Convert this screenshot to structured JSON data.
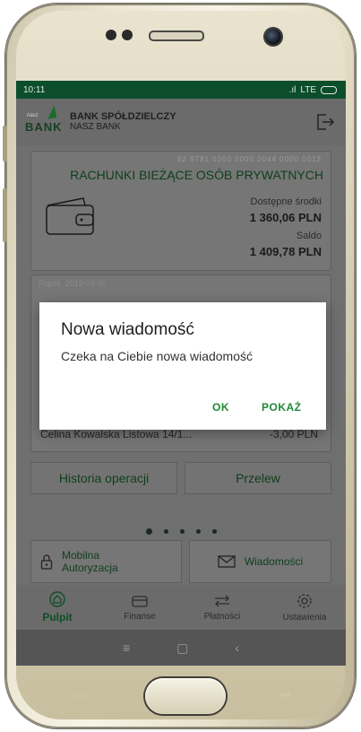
{
  "status": {
    "time": "10:11",
    "network": "LTE"
  },
  "header": {
    "logo_small": "nasz",
    "logo_text": "BANK",
    "bank_name": "BANK SPÓŁDZIELCZY",
    "bank_sub": "NASZ BANK"
  },
  "account": {
    "number": "82 8781 0000 0000 0044 0000 0013",
    "title": "RACHUNKI BIEŻĄCE OSÓB PRYWATNYCH",
    "available_label": "Dostępne środki",
    "available_value": "1 360,06 PLN",
    "balance_label": "Saldo",
    "balance_value": "1 409,78 PLN"
  },
  "operations": {
    "date": "Piątek, 2019-08-30",
    "row_name": "Celina Kowalska Listowa 14/1...",
    "row_amount": "-3,00 PLN"
  },
  "buttons": {
    "history": "Historia operacji",
    "transfer": "Przelew"
  },
  "pager": {
    "count": 5,
    "active": 0
  },
  "tiles": {
    "auth": "Mobilna\nAutoryzacja",
    "messages": "Wiadomości"
  },
  "tabs": [
    {
      "label": "Pulpit",
      "icon": "home-icon"
    },
    {
      "label": "Finanse",
      "icon": "wallet-icon"
    },
    {
      "label": "Płatności",
      "icon": "transfer-icon"
    },
    {
      "label": "Ustawienia",
      "icon": "gear-icon"
    }
  ],
  "dialog": {
    "title": "Nowa wiadomość",
    "message": "Czeka na Ciebie nowa wiadomość",
    "ok": "OK",
    "show": "POKAŻ"
  },
  "colors": {
    "brand_green": "#0c4e2b",
    "accent_green": "#1d8a3a"
  }
}
